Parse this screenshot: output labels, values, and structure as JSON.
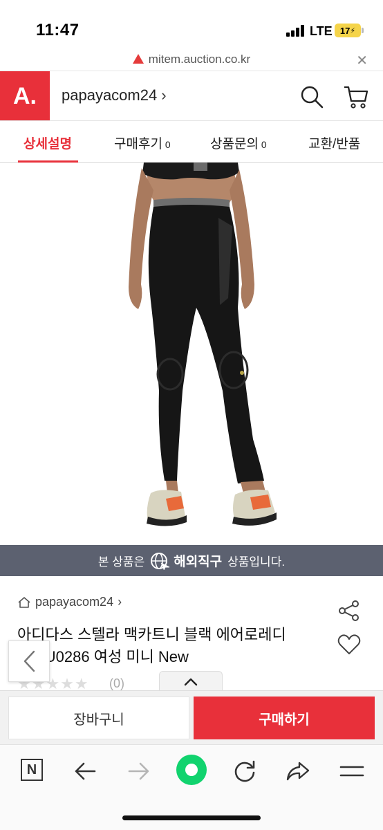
{
  "status_bar": {
    "time": "11:47",
    "network": "LTE",
    "battery": "17"
  },
  "url_bar": {
    "domain": "mitem.auction.co.kr",
    "warning_icon": "warning-icon",
    "close_icon": "close-icon"
  },
  "header": {
    "logo": "A.",
    "shop_name": "papayacom24",
    "chevron": "›",
    "search_icon": "search-icon",
    "cart_icon": "cart-icon"
  },
  "tabs": [
    {
      "label": "상세설명",
      "count": "",
      "active": true
    },
    {
      "label": "구매후기",
      "count": "0",
      "active": false
    },
    {
      "label": "상품문의",
      "count": "0",
      "active": false
    },
    {
      "label": "교환/반품",
      "count": "",
      "active": false
    }
  ],
  "banner": {
    "prefix": "본 상품은",
    "highlight": "해외직구",
    "suffix": "상품입니다."
  },
  "product": {
    "seller": "papayacom24",
    "seller_chevron": "›",
    "title_line1": "아디다스 스텔라 맥카트니 블랙 에어로레디",
    "title_line2": "스 FU0286 여성 미니 New",
    "stars": "★★★★★",
    "review_count": "(0)"
  },
  "actions": {
    "cart_label": "장바구니",
    "buy_label": "구매하기"
  },
  "colors": {
    "brand_red": "#e8303a",
    "banner_gray": "#5c6170",
    "naver_green": "#11d36e"
  },
  "browser_bar": {
    "n_label": "N",
    "icons": [
      "n-icon",
      "back-arrow-icon",
      "forward-arrow-icon",
      "green-circle-icon",
      "refresh-icon",
      "share-icon",
      "menu-icon"
    ]
  }
}
